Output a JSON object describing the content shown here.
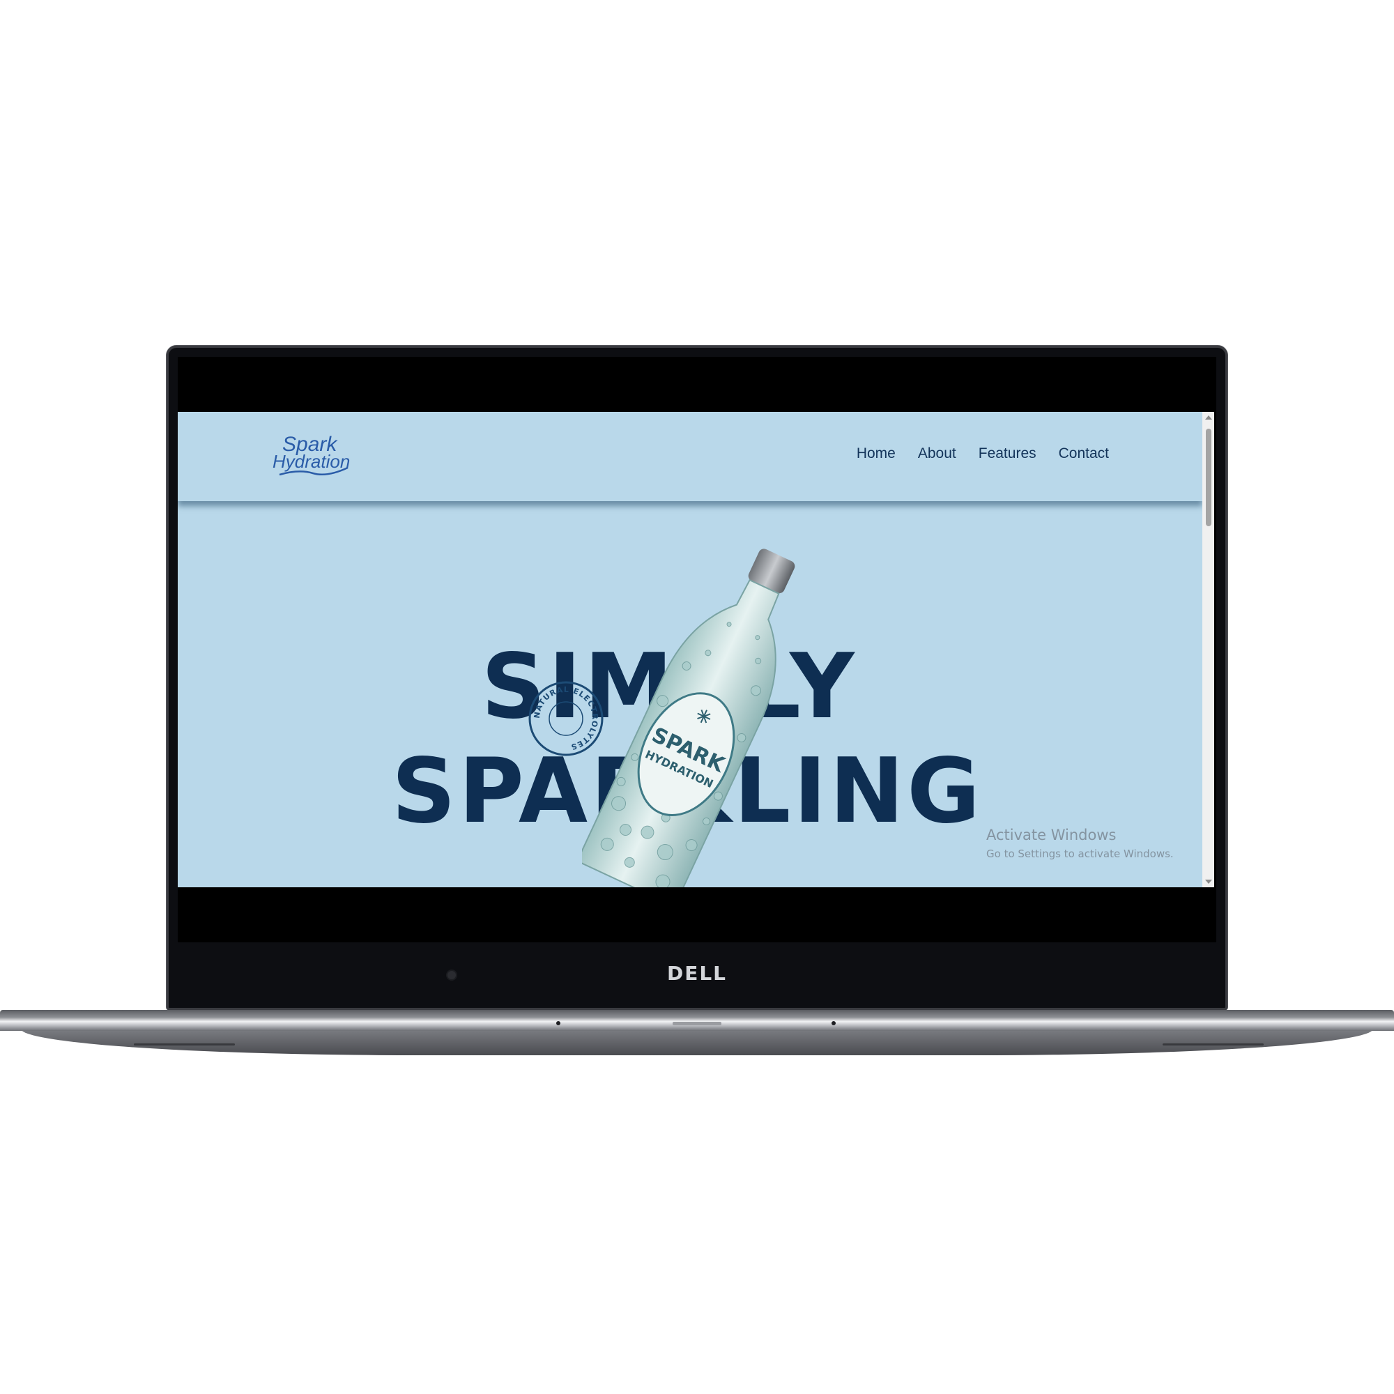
{
  "device": {
    "brand": "DELL"
  },
  "site": {
    "logo_line1": "Spark",
    "logo_line2": "Hydration",
    "nav": [
      {
        "label": "Home"
      },
      {
        "label": "About"
      },
      {
        "label": "Features"
      },
      {
        "label": "Contact"
      }
    ]
  },
  "hero": {
    "line1": "SIMPLY",
    "line2": "SPARKLING",
    "badge_text": "NATURAL ELECTROLYTES",
    "bottle_label_line1": "SPARK",
    "bottle_label_line2": "HYDRATION"
  },
  "watermark": {
    "title": "Activate Windows",
    "subtitle": "Go to Settings to activate Windows."
  },
  "colors": {
    "background": "#b9d8ea",
    "text_primary": "#0e2e52",
    "nav_text": "#13345a",
    "logo_blue": "#2a5ca8"
  }
}
